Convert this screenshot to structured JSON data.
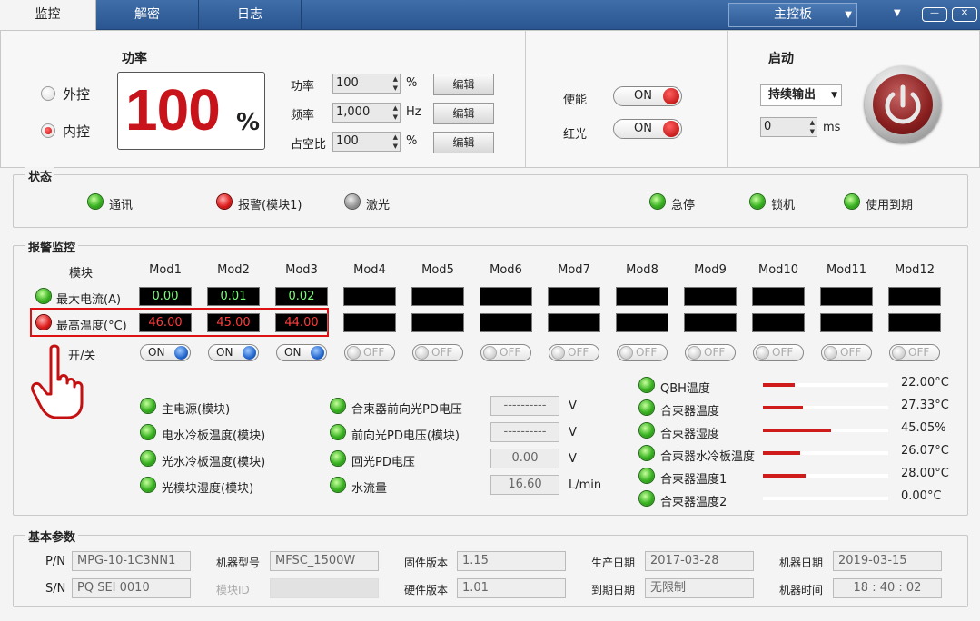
{
  "tabs": [
    {
      "label": "监控",
      "active": true
    },
    {
      "label": "解密",
      "active": false
    },
    {
      "label": "日志",
      "active": false
    }
  ],
  "board_select": {
    "value": "主控板"
  },
  "control_mode": {
    "external_label": "外控",
    "internal_label": "内控",
    "selected": "internal"
  },
  "power": {
    "title": "功率",
    "value": "100",
    "unit": "%"
  },
  "settings": [
    {
      "label": "功率",
      "value": "100",
      "unit": "%",
      "button": "编辑"
    },
    {
      "label": "频率",
      "value": "1,000",
      "unit": "Hz",
      "button": "编辑"
    },
    {
      "label": "占空比",
      "value": "100",
      "unit": "%",
      "button": "编辑"
    }
  ],
  "enable": {
    "label": "使能",
    "state": "ON"
  },
  "red_light": {
    "label": "红光",
    "state": "ON"
  },
  "start": {
    "title": "启动",
    "mode": "持续输出",
    "delay_value": "0",
    "delay_unit": "ms"
  },
  "status": {
    "title": "状态",
    "items": [
      {
        "label": "通讯",
        "color": "green"
      },
      {
        "label": "报警(模块1)",
        "color": "red"
      },
      {
        "label": "激光",
        "color": "gray"
      },
      {
        "label": "急停",
        "color": "green"
      },
      {
        "label": "锁机",
        "color": "green"
      },
      {
        "label": "使用到期",
        "color": "green"
      }
    ]
  },
  "alarm": {
    "title": "报警监控",
    "module_header": "模块",
    "modules": [
      "Mod1",
      "Mod2",
      "Mod3",
      "Mod4",
      "Mod5",
      "Mod6",
      "Mod7",
      "Mod8",
      "Mod9",
      "Mod10",
      "Mod11",
      "Mod12"
    ],
    "max_current_label": "最大电流(A)",
    "max_current": [
      "0.00",
      "0.01",
      "0.02",
      "",
      "",
      "",
      "",
      "",
      "",
      "",
      "",
      ""
    ],
    "max_temp_label": "最高温度(°C)",
    "max_temp": [
      "46.00",
      "45.00",
      "44.00",
      "",
      "",
      "",
      "",
      "",
      "",
      "",
      "",
      ""
    ],
    "switch_label": "开/关",
    "switches": [
      "ON",
      "ON",
      "ON",
      "OFF",
      "OFF",
      "OFF",
      "OFF",
      "OFF",
      "OFF",
      "OFF",
      "OFF",
      "OFF"
    ],
    "indicators_left": [
      "主电源(模块)",
      "电水冷板温度(模块)",
      "光水冷板温度(模块)",
      "光模块湿度(模块)"
    ],
    "indicators_mid": [
      {
        "label": "合束器前向光PD电压",
        "value": "----------",
        "unit": "V"
      },
      {
        "label": "前向光PD电压(模块)",
        "value": "----------",
        "unit": "V"
      },
      {
        "label": "回光PD电压",
        "value": "0.00",
        "unit": "V"
      },
      {
        "label": "水流量",
        "value": "16.60",
        "unit": "L/min"
      }
    ],
    "indicators_right": [
      {
        "label": "QBH温度",
        "value": "22.00°C",
        "level": 0.25
      },
      {
        "label": "合束器温度",
        "value": "27.33°C",
        "level": 0.32
      },
      {
        "label": "合束器湿度",
        "value": "45.05%",
        "level": 0.54
      },
      {
        "label": "合束器水冷板温度",
        "value": "26.07°C",
        "level": 0.3
      },
      {
        "label": "合束器温度1",
        "value": "28.00°C",
        "level": 0.34
      },
      {
        "label": "合束器温度2",
        "value": "0.00°C",
        "level": 0.0
      }
    ]
  },
  "params": {
    "title": "基本参数",
    "pn_label": "P/N",
    "pn": "MPG-10-1C3NN1",
    "sn_label": "S/N",
    "sn": "PQ SEI 0010",
    "machine_model_label": "机器型号",
    "machine_model": "MFSC_1500W",
    "module_id_label": "模块ID",
    "module_id": "",
    "firmware_label": "固件版本",
    "firmware": "1.15",
    "hardware_label": "硬件版本",
    "hardware": "1.01",
    "prod_date_label": "生产日期",
    "prod_date": "2017-03-28",
    "expire_label": "到期日期",
    "expire": "无限制",
    "machine_date_label": "机器日期",
    "machine_date": "2019-03-15",
    "machine_time_label": "机器时间",
    "machine_time": "18 : 40 : 02"
  }
}
